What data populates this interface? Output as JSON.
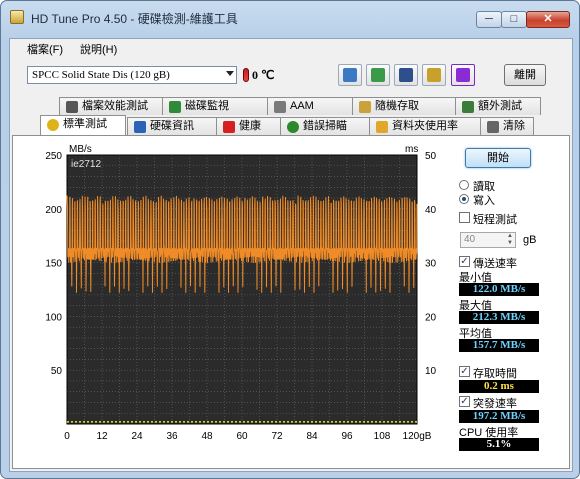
{
  "window": {
    "title": "HD Tune Pro 4.50 - 硬碟檢測-維護工具",
    "min": "─",
    "max": "□",
    "close": "✕"
  },
  "menu": [
    {
      "label": "檔案(F)"
    },
    {
      "label": "說明(H)"
    }
  ],
  "toolbar": {
    "drive": "SPCC Solid State Dis    (120 gB)",
    "temperature": "0 ℃",
    "exit_label": "離開",
    "buttons": [
      {
        "icon": "copy-text-icon",
        "color": "#3b7ac2"
      },
      {
        "icon": "copy-screenshot-icon",
        "color": "#3a9a4a"
      },
      {
        "icon": "save-icon",
        "color": "#2d4f8c"
      },
      {
        "icon": "options-icon",
        "color": "#c8a12a"
      },
      {
        "icon": "download-icon",
        "color": "#8a2bd6"
      }
    ]
  },
  "tabs_top": [
    {
      "label": "檔案效能測試",
      "icon": "file-benchmark-icon",
      "color": "#555"
    },
    {
      "label": "磁碟監視",
      "icon": "disk-monitor-icon",
      "color": "#2f8a3a"
    },
    {
      "label": "AAM",
      "icon": "speaker-icon",
      "color": "#7a7a7a"
    },
    {
      "label": "隨機存取",
      "icon": "random-access-icon",
      "color": "#c9a23b"
    },
    {
      "label": "額外測試",
      "icon": "extra-tests-icon",
      "color": "#3a7d3a"
    }
  ],
  "tabs_bottom": [
    {
      "label": "標準測試",
      "icon": "benchmark-icon",
      "color": "#e0b21a"
    },
    {
      "label": "硬碟資訊",
      "icon": "info-icon",
      "color": "#2a63b8"
    },
    {
      "label": "健康",
      "icon": "health-cross-icon",
      "color": "#d42020"
    },
    {
      "label": "錯誤掃瞄",
      "icon": "error-scan-icon",
      "color": "#2c8a2c"
    },
    {
      "label": "資料夾使用率",
      "icon": "folder-usage-icon",
      "color": "#e0a72a"
    },
    {
      "label": "清除",
      "icon": "erase-icon",
      "color": "#666"
    }
  ],
  "controls": {
    "start_label": "開始",
    "read_label": "讀取",
    "write_label": "寫入",
    "short_test_label": "短程測試",
    "size_value": "40",
    "size_unit": "gB",
    "transfer_label": "傳送速率",
    "min_label": "最小值",
    "min_value": "122.0 MB/s",
    "max_label": "最大值",
    "max_value": "212.3 MB/s",
    "avg_label": "平均值",
    "avg_value": "157.7 MB/s",
    "access_label": "存取時間",
    "access_value": "0.2 ms",
    "burst_label": "突發速率",
    "burst_value": "197.2 MB/s",
    "cpu_label": "CPU 使用率",
    "cpu_value": "5.1%"
  },
  "chart_data": {
    "type": "line",
    "graph_label": "ie2712",
    "ylabel_left": "MB/s",
    "ylabel_right": "ms",
    "ylim": [
      0,
      250
    ],
    "ylim_right": [
      0,
      50
    ],
    "xlim": [
      0,
      120
    ],
    "xlabel": "gB",
    "yticks_left": [
      50,
      100,
      150,
      200,
      250
    ],
    "yticks_right": [
      10,
      20,
      30,
      40,
      50
    ],
    "xticks": [
      0,
      12,
      24,
      36,
      48,
      60,
      72,
      84,
      96,
      108,
      120
    ],
    "grid": true,
    "colors": {
      "transfer": "#f08c28",
      "access": "#e8e82a",
      "background": "#2b2b2b",
      "grid": "#6a6a6a"
    },
    "transfer_pattern": {
      "min": 122.0,
      "max": 212.3,
      "average": 157.7,
      "peaks_per_gB": 1.15
    },
    "access_time_ms": 0.2
  }
}
